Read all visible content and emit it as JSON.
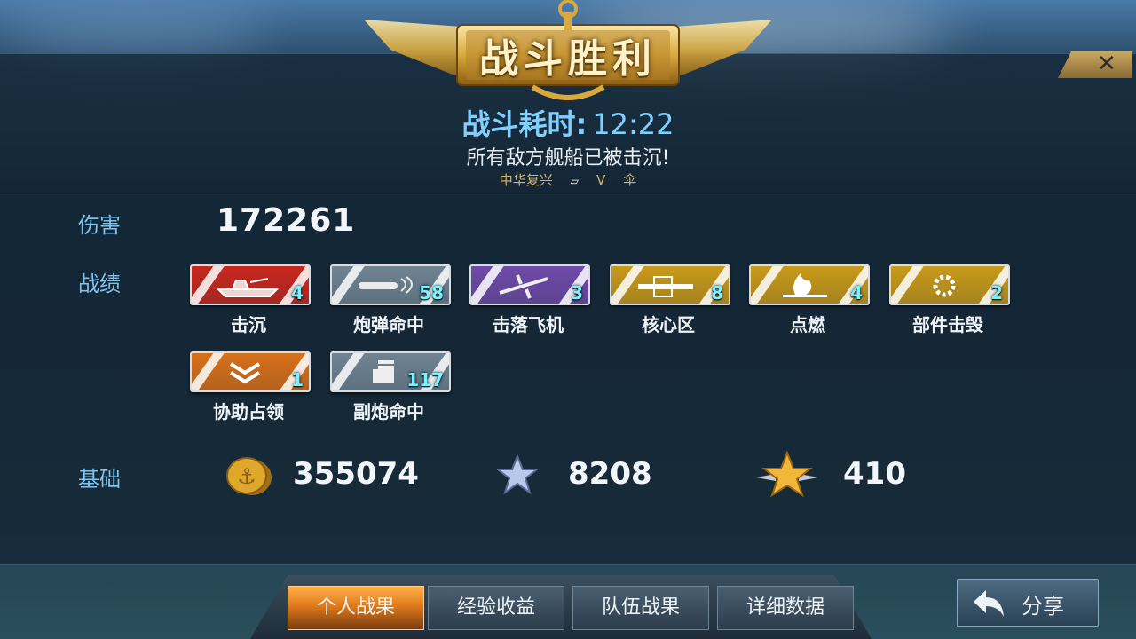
{
  "banner": {
    "title": "战斗胜利"
  },
  "close": {
    "glyph": "✕"
  },
  "battle": {
    "time_label": "战斗耗时:",
    "time_value": "12:22",
    "result_text": "所有敌方舰船已被击沉!",
    "ship_name": "中华复兴",
    "tier": "V",
    "extra_glyph": "伞"
  },
  "damage": {
    "label": "伤害",
    "value": "172261"
  },
  "record": {
    "label": "战绩",
    "medals": [
      {
        "name": "击沉",
        "count": "4",
        "color": "#c8281e",
        "icon": "ship-icon"
      },
      {
        "name": "炮弹命中",
        "count": "58",
        "color": "#6f8392",
        "icon": "shell-icon"
      },
      {
        "name": "击落飞机",
        "count": "3",
        "color": "#6f4aa8",
        "icon": "plane-icon"
      },
      {
        "name": "核心区",
        "count": "8",
        "color": "#c99a1a",
        "icon": "citadel-icon"
      },
      {
        "name": "点燃",
        "count": "4",
        "color": "#c99a1a",
        "icon": "fire-icon"
      },
      {
        "name": "部件击毁",
        "count": "2",
        "color": "#c99a1a",
        "icon": "gear-icon"
      },
      {
        "name": "协助占领",
        "count": "1",
        "color": "#d9701a",
        "icon": "chevron-icon"
      },
      {
        "name": "副炮命中",
        "count": "117",
        "color": "#6f8392",
        "icon": "turret-icon"
      }
    ]
  },
  "base": {
    "label": "基础",
    "credits": "355074",
    "exp": "8208",
    "commander_exp": "410"
  },
  "tabs": [
    "个人战果",
    "经验收益",
    "队伍战果",
    "详细数据"
  ],
  "share": {
    "label": "分享"
  }
}
